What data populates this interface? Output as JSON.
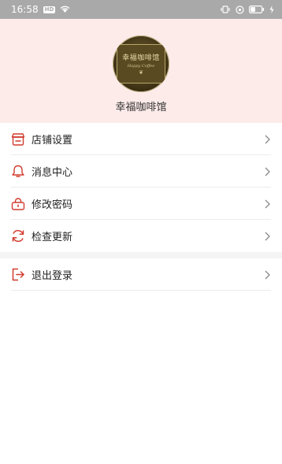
{
  "status_bar": {
    "time": "16:58",
    "left_icons": [
      "notification-badge-icon",
      "wifi-icon"
    ],
    "right_icons": [
      "vibrate-icon",
      "sync-icon",
      "battery-icon",
      "charging-icon"
    ]
  },
  "profile": {
    "logo_text": "幸福咖啡馆",
    "logo_subtext": "Happy Coffee",
    "shop_name": "幸福咖啡馆"
  },
  "menu": {
    "items": [
      {
        "label": "店铺设置",
        "icon": "store-icon"
      },
      {
        "label": "消息中心",
        "icon": "bell-icon"
      },
      {
        "label": "修改密码",
        "icon": "lock-icon"
      },
      {
        "label": "检查更新",
        "icon": "refresh-icon"
      }
    ],
    "logout": {
      "label": "退出登录",
      "icon": "logout-icon"
    }
  },
  "colors": {
    "accent": "#d23b2f",
    "header_bg": "#fcebe9",
    "status_bar_bg": "#a9a9a9"
  }
}
